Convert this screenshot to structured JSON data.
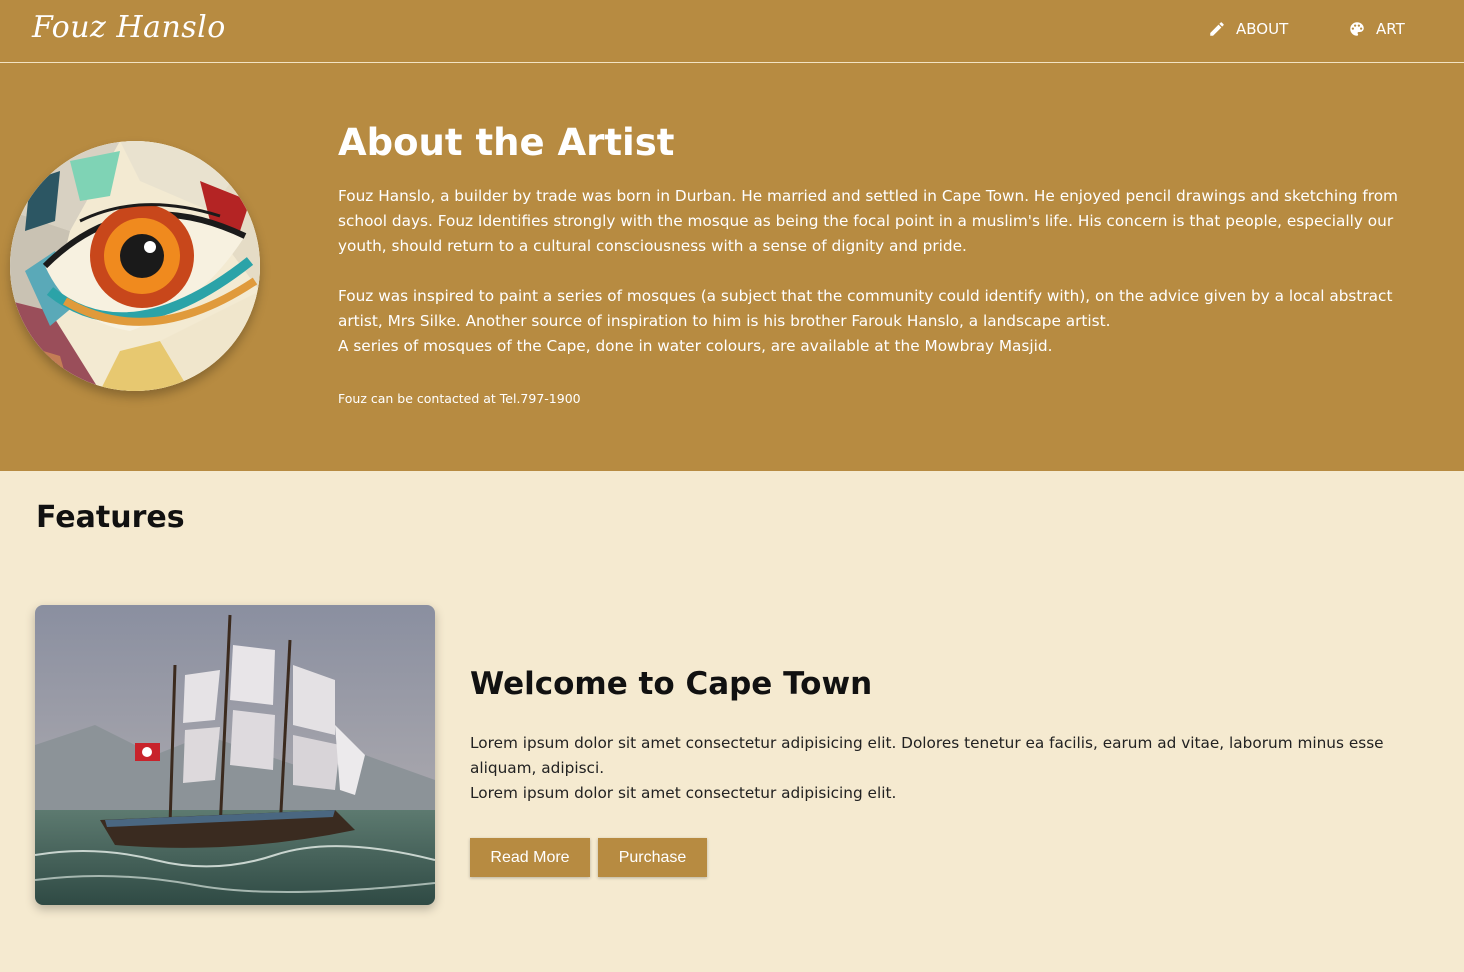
{
  "brand": "Fouz Hanslo",
  "nav": {
    "about_label": "ABOUT",
    "art_label": "ART"
  },
  "about": {
    "title": "About the Artist",
    "paragraph1": "Fouz Hanslo, a builder by trade was born in Durban. He married and settled in Cape Town. He enjoyed pencil drawings and sketching from school days. Fouz Identifies strongly with the mosque as being the focal point in a muslim's life. His concern is that people, especially our youth, should return to a cultural consciousness with a sense of dignity and pride.",
    "paragraph2": "Fouz was inspired to paint a series of mosques (a subject that the community could identify with), on the advice given by a local abstract artist, Mrs Silke. Another source of inspiration to him is his brother Farouk Hanslo, a landscape artist.",
    "paragraph3": "A series of mosques of the Cape, done in water colours, are available at the Mowbray Masjid.",
    "contact": "Fouz can be contacted at Tel.797-1900"
  },
  "features": {
    "title": "Features",
    "item": {
      "title": "Welcome to Cape Town",
      "line1": "Lorem ipsum dolor sit amet consectetur adipisicing elit. Dolores tenetur ea facilis, earum ad vitae, laborum minus esse aliquam, adipisci.",
      "line2": "Lorem ipsum dolor sit amet consectetur adipisicing elit.",
      "read_more": "Read More",
      "purchase": "Purchase"
    }
  },
  "colors": {
    "brand": "#b78b41",
    "background": "#f5ead0"
  },
  "icons": {
    "about": "pencil-icon",
    "art": "palette-icon"
  }
}
